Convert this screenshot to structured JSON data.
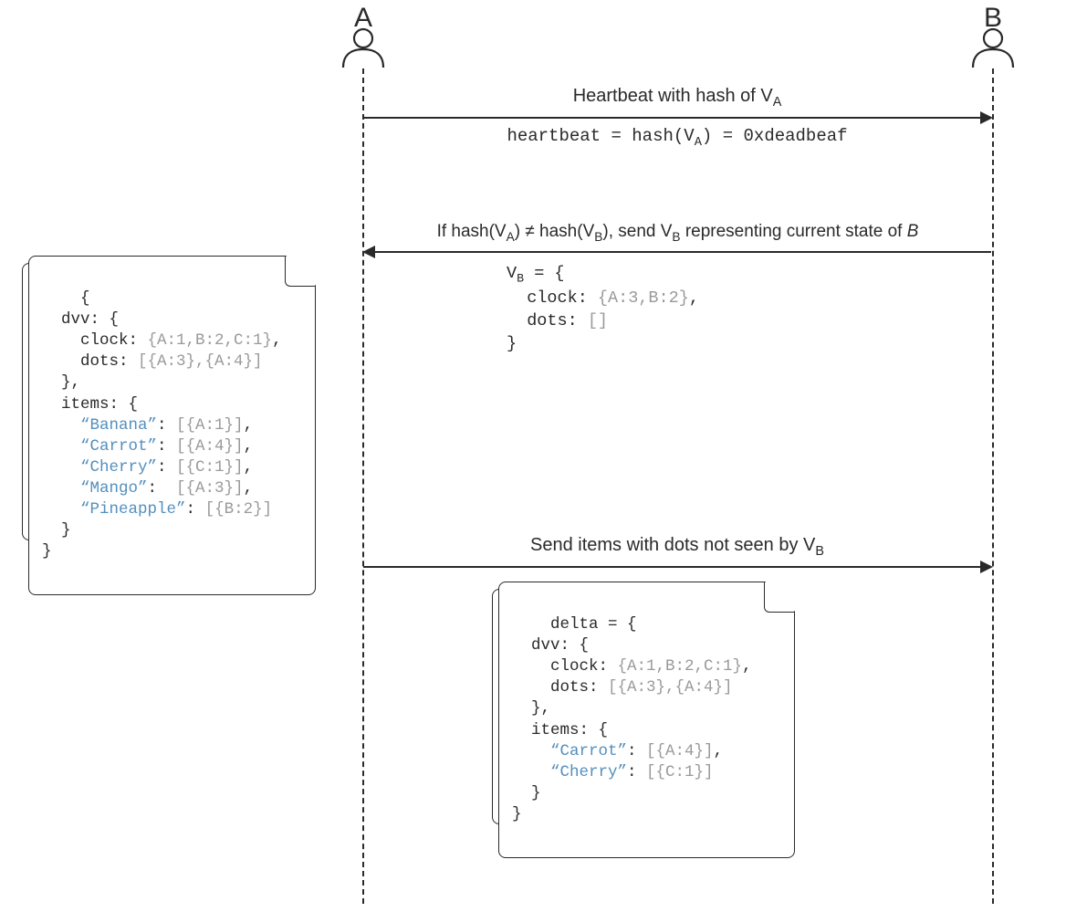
{
  "actors": {
    "a": "A",
    "b": "B"
  },
  "arrow1": {
    "above": "Heartbeat with hash of V<sub>A</sub>",
    "below": "heartbeat = hash(V<sub>A</sub>) = 0xdeadbeaf"
  },
  "arrow2": {
    "above": "If hash(V<sub>A</sub>) ≠ hash(V<sub>B</sub>), send V<sub>B</sub> representing current state of <i>B</i>",
    "code": "V<sub>B</sub> = {\n  clock: <span class=\"code-val\">{A:3,B:2}</span>,\n  dots: <span class=\"code-val\">[]</span>\n}"
  },
  "arrow3": {
    "above": "Send items with dots not seen by V<sub>B</sub>"
  },
  "noteA": "{\n  dvv: {\n    clock: <span class=\"code-val\">{A:1,B:2,C:1}</span>,\n    dots: <span class=\"code-val\">[{A:3},{A:4}]</span>\n  },\n  items: {\n    <span class=\"code-key\">“Banana”</span>: <span class=\"code-val\">[{A:1}]</span>,\n    <span class=\"code-key\">“Carrot”</span>: <span class=\"code-val\">[{A:4}]</span>,\n    <span class=\"code-key\">“Cherry”</span>: <span class=\"code-val\">[{C:1}]</span>,\n    <span class=\"code-key\">“Mango”</span>:  <span class=\"code-val\">[{A:3}]</span>,\n    <span class=\"code-key\">“Pineapple”</span>: <span class=\"code-val\">[{B:2}]</span>\n  }\n}",
  "noteDelta": "delta = {\n  dvv: {\n    clock: <span class=\"code-val\">{A:1,B:2,C:1}</span>,\n    dots: <span class=\"code-val\">[{A:3},{A:4}]</span>\n  },\n  items: {\n    <span class=\"code-key\">“Carrot”</span>: <span class=\"code-val\">[{A:4}]</span>,\n    <span class=\"code-key\">“Cherry”</span>: <span class=\"code-val\">[{C:1}]</span>\n  }\n}"
}
